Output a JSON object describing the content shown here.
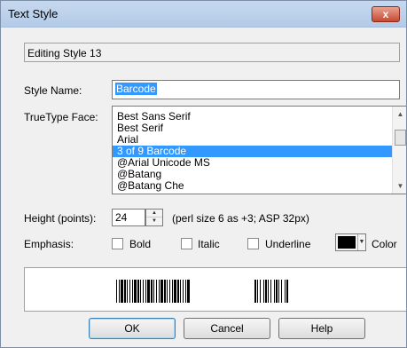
{
  "window": {
    "title": "Text Style",
    "close_label": "x"
  },
  "status": "Editing Style 13",
  "style_name": {
    "label": "Style Name:",
    "value": "Barcode"
  },
  "truetype": {
    "label": "TrueType Face:",
    "items": [
      "Best Sans Serif",
      "Best Serif",
      "Arial",
      "3 of 9 Barcode",
      "@Arial Unicode MS",
      "@Batang",
      "@Batang Che"
    ],
    "selected_index": 3
  },
  "height": {
    "label": "Height (points):",
    "value": "24",
    "hint": "(perl size 6 as +3; ASP 32px)"
  },
  "emphasis": {
    "label": "Emphasis:",
    "bold": {
      "label": "Bold",
      "checked": false
    },
    "italic": {
      "label": "Italic",
      "checked": false
    },
    "underline": {
      "label": "Underline",
      "checked": false
    },
    "color_label": "Color",
    "color_value": "#000000"
  },
  "buttons": {
    "ok": "OK",
    "cancel": "Cancel",
    "help": "Help"
  },
  "colors": {
    "selection": "#3399ff",
    "titlebar": "#b9cfea",
    "dialog_bg": "#f0f0f0"
  }
}
